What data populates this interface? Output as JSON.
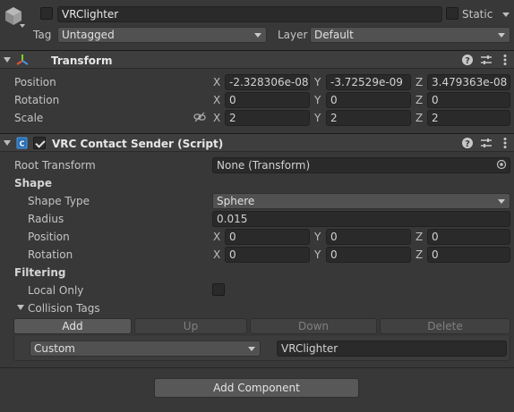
{
  "object": {
    "name": "VRClighter",
    "static_label": "Static",
    "tag_label": "Tag",
    "tag_value": "Untagged",
    "layer_label": "Layer",
    "layer_value": "Default"
  },
  "transform": {
    "title": "Transform",
    "position": {
      "label": "Position",
      "x": "-2.328306e-08",
      "y": "-3.72529e-09",
      "z": "3.479363e-08"
    },
    "rotation": {
      "label": "Rotation",
      "x": "0",
      "y": "0",
      "z": "0"
    },
    "scale": {
      "label": "Scale",
      "x": "2",
      "y": "2",
      "z": "2"
    }
  },
  "axes": {
    "x": "X",
    "y": "Y",
    "z": "Z"
  },
  "contact_sender": {
    "title": "VRC Contact Sender (Script)",
    "root_transform_label": "Root Transform",
    "root_transform_value": "None (Transform)",
    "shape_header": "Shape",
    "shape_type_label": "Shape Type",
    "shape_type_value": "Sphere",
    "radius_label": "Radius",
    "radius_value": "0.015",
    "position": {
      "label": "Position",
      "x": "0",
      "y": "0",
      "z": "0"
    },
    "rotation": {
      "label": "Rotation",
      "x": "0",
      "y": "0",
      "z": "0"
    },
    "filtering_header": "Filtering",
    "local_only_label": "Local Only",
    "collision_tags_label": "Collision Tags",
    "buttons": {
      "add": "Add",
      "up": "Up",
      "down": "Down",
      "delete": "Delete"
    },
    "tag_item": {
      "type": "Custom",
      "value": "VRClighter"
    }
  },
  "add_component_label": "Add Component",
  "colors": {
    "background": "#383838",
    "field": "#2a2a2a",
    "header": "#3e3e3e",
    "script_icon": "#4a9be8"
  }
}
